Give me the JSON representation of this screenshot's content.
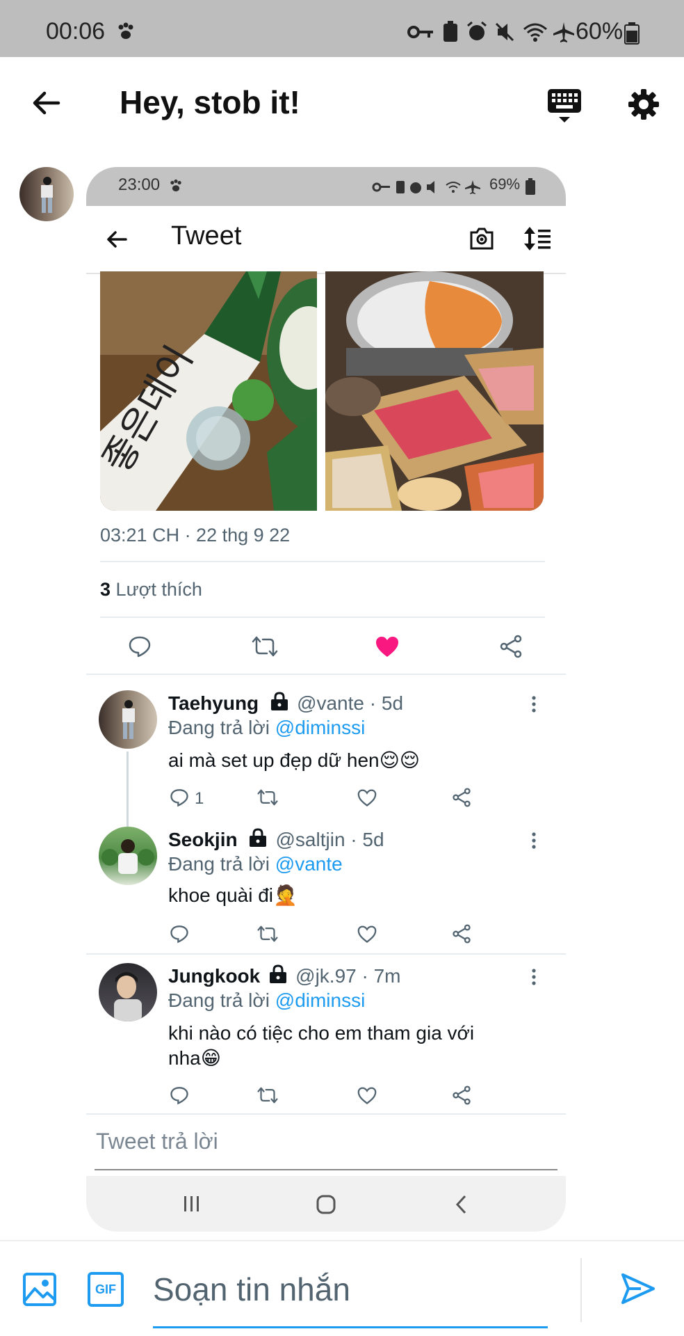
{
  "status_bar": {
    "time": "00:06",
    "battery": "60%"
  },
  "header": {
    "title": "Hey, stob it!"
  },
  "shared_screenshot": {
    "status_bar": {
      "time": "23:00",
      "battery": "69%"
    },
    "title": "Tweet",
    "tweet": {
      "datetime": "03:21 CH · 22 thg 9 22",
      "likes_count": "3",
      "likes_label": "Lượt thích"
    },
    "replies": [
      {
        "name": "Taehyung",
        "handle": "@vante · 5d",
        "replying_prefix": "Đang trả lời",
        "replying_to": "@diminssi",
        "text": "ai mà set up đẹp dữ hen😌😌",
        "reply_count": "1"
      },
      {
        "name": "Seokjin",
        "handle": "@saltjin · 5d",
        "replying_prefix": "Đang trả lời",
        "replying_to": "@vante",
        "text": "khoe quài đi🤦"
      },
      {
        "name": "Jungkook",
        "handle": "@jk.97 · 7m",
        "replying_prefix": "Đang trả lời",
        "replying_to": "@diminssi",
        "text_line1": "khi nào có tiệc cho em tham gia với",
        "text_line2": "nha😁"
      }
    ],
    "reply_placeholder": "Tweet trả lời"
  },
  "composer": {
    "placeholder": "Soạn tin nhắn",
    "gif_label": "GIF"
  },
  "colors": {
    "accent": "#1d9bf0",
    "like": "#f91880",
    "status_bar_bg": "#bdbdbd"
  }
}
